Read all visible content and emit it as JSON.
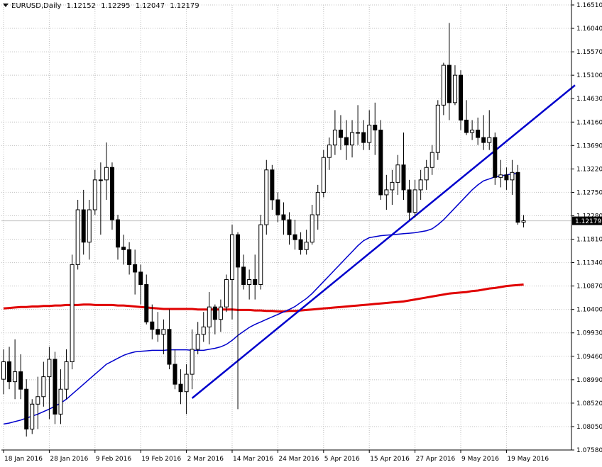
{
  "header": {
    "symbol": "EURUSD,Daily",
    "open": "1.12152",
    "high": "1.12295",
    "low": "1.12047",
    "close": "1.12179"
  },
  "colors": {
    "up_body": "#ffffff",
    "down_body": "#000000",
    "ma_slow": "#e00000",
    "ma_fast": "#0000cc",
    "trendline": "#0000cc",
    "grid": "#c0c0c0",
    "price_label_bg": "#000000"
  },
  "chart_data": {
    "type": "candlestick",
    "ylim": [
      1.0758,
      1.1651
    ],
    "y_ticks": [
      "1.16510",
      "1.16040",
      "1.15570",
      "1.15100",
      "1.14630",
      "1.14160",
      "1.13690",
      "1.13220",
      "1.12750",
      "1.12280",
      "1.11810",
      "1.11340",
      "1.10870",
      "1.10400",
      "1.09930",
      "1.09460",
      "1.08990",
      "1.08520",
      "1.08050",
      "1.07580"
    ],
    "x_labels": [
      {
        "label": "18 Jan 2016",
        "index": 0
      },
      {
        "label": "28 Jan 2016",
        "index": 8
      },
      {
        "label": "9 Feb 2016",
        "index": 16
      },
      {
        "label": "19 Feb 2016",
        "index": 24
      },
      {
        "label": "2 Mar 2016",
        "index": 32
      },
      {
        "label": "14 Mar 2016",
        "index": 40
      },
      {
        "label": "24 Mar 2016",
        "index": 48
      },
      {
        "label": "5 Apr 2016",
        "index": 56
      },
      {
        "label": "15 Apr 2016",
        "index": 64
      },
      {
        "label": "27 Apr 2016",
        "index": 72
      },
      {
        "label": "9 May 2016",
        "index": 80
      },
      {
        "label": "19 May 2016",
        "index": 88
      }
    ],
    "current_price": "1.12179",
    "candles": [
      [
        1.09,
        1.096,
        1.087,
        1.0935
      ],
      [
        1.0935,
        1.0965,
        1.088,
        1.0895
      ],
      [
        1.0895,
        1.098,
        1.086,
        1.0915
      ],
      [
        1.0915,
        1.095,
        1.086,
        1.088
      ],
      [
        1.088,
        1.09,
        1.0785,
        1.08
      ],
      [
        1.08,
        1.086,
        1.079,
        1.085
      ],
      [
        1.085,
        1.0905,
        1.08,
        1.0865
      ],
      [
        1.0865,
        1.0935,
        1.0845,
        1.0905
      ],
      [
        1.0905,
        1.0965,
        1.082,
        1.094
      ],
      [
        1.094,
        1.0955,
        1.081,
        1.083
      ],
      [
        1.083,
        1.092,
        1.081,
        1.088
      ],
      [
        1.088,
        1.096,
        1.086,
        1.0935
      ],
      [
        1.0935,
        1.115,
        1.092,
        1.113
      ],
      [
        1.113,
        1.126,
        1.112,
        1.124
      ],
      [
        1.124,
        1.128,
        1.115,
        1.1175
      ],
      [
        1.1175,
        1.126,
        1.114,
        1.124
      ],
      [
        1.124,
        1.132,
        1.123,
        1.13
      ],
      [
        1.13,
        1.1335,
        1.119,
        1.13
      ],
      [
        1.13,
        1.1375,
        1.126,
        1.1325
      ],
      [
        1.1325,
        1.1335,
        1.12,
        1.122
      ],
      [
        1.122,
        1.123,
        1.114,
        1.1165
      ],
      [
        1.1165,
        1.119,
        1.113,
        1.116
      ],
      [
        1.116,
        1.1175,
        1.111,
        1.113
      ],
      [
        1.113,
        1.116,
        1.107,
        1.1115
      ],
      [
        1.1115,
        1.113,
        1.105,
        1.109
      ],
      [
        1.109,
        1.111,
        1.101,
        1.1015
      ],
      [
        1.1015,
        1.105,
        1.098,
        1.1
      ],
      [
        1.1,
        1.1035,
        1.0975,
        1.099
      ],
      [
        1.099,
        1.102,
        1.095,
        1.1
      ],
      [
        1.1,
        1.104,
        1.092,
        1.093
      ],
      [
        1.093,
        1.096,
        1.088,
        1.089
      ],
      [
        1.089,
        1.092,
        1.085,
        1.0875
      ],
      [
        1.0875,
        1.093,
        1.083,
        1.091
      ],
      [
        1.091,
        1.1,
        1.088,
        1.096
      ],
      [
        1.096,
        1.1015,
        1.095,
        1.099
      ],
      [
        1.099,
        1.1035,
        1.0975,
        1.1005
      ],
      [
        1.1005,
        1.1075,
        1.097,
        1.1045
      ],
      [
        1.1045,
        1.105,
        1.099,
        1.102
      ],
      [
        1.102,
        1.106,
        1.0995,
        1.1045
      ],
      [
        1.1045,
        1.111,
        1.1035,
        1.11
      ],
      [
        1.11,
        1.121,
        1.102,
        1.119
      ],
      [
        1.119,
        1.1195,
        1.084,
        1.1125
      ],
      [
        1.1125,
        1.115,
        1.108,
        1.109
      ],
      [
        1.109,
        1.112,
        1.106,
        1.11
      ],
      [
        1.11,
        1.115,
        1.106,
        1.109
      ],
      [
        1.109,
        1.123,
        1.108,
        1.121
      ],
      [
        1.121,
        1.134,
        1.119,
        1.132
      ],
      [
        1.132,
        1.133,
        1.124,
        1.126
      ],
      [
        1.126,
        1.1275,
        1.1215,
        1.123
      ],
      [
        1.123,
        1.1255,
        1.119,
        1.122
      ],
      [
        1.122,
        1.1235,
        1.117,
        1.119
      ],
      [
        1.119,
        1.122,
        1.116,
        1.118
      ],
      [
        1.118,
        1.1195,
        1.115,
        1.116
      ],
      [
        1.116,
        1.12,
        1.115,
        1.1175
      ],
      [
        1.1175,
        1.125,
        1.117,
        1.123
      ],
      [
        1.123,
        1.129,
        1.12,
        1.1275
      ],
      [
        1.1275,
        1.136,
        1.1265,
        1.1345
      ],
      [
        1.1345,
        1.1385,
        1.132,
        1.137
      ],
      [
        1.137,
        1.144,
        1.135,
        1.14
      ],
      [
        1.14,
        1.143,
        1.136,
        1.1385
      ],
      [
        1.1385,
        1.142,
        1.134,
        1.137
      ],
      [
        1.137,
        1.142,
        1.1345,
        1.1395
      ],
      [
        1.1395,
        1.145,
        1.137,
        1.1395
      ],
      [
        1.1395,
        1.142,
        1.136,
        1.1375
      ],
      [
        1.1375,
        1.144,
        1.136,
        1.141
      ],
      [
        1.141,
        1.1455,
        1.135,
        1.14
      ],
      [
        1.14,
        1.142,
        1.126,
        1.127
      ],
      [
        1.127,
        1.131,
        1.124,
        1.128
      ],
      [
        1.128,
        1.132,
        1.125,
        1.1295
      ],
      [
        1.1295,
        1.135,
        1.127,
        1.133
      ],
      [
        1.133,
        1.1395,
        1.126,
        1.128
      ],
      [
        1.128,
        1.13,
        1.122,
        1.1235
      ],
      [
        1.1235,
        1.13,
        1.1225,
        1.128
      ],
      [
        1.128,
        1.132,
        1.126,
        1.13
      ],
      [
        1.13,
        1.134,
        1.128,
        1.1325
      ],
      [
        1.1325,
        1.137,
        1.131,
        1.1355
      ],
      [
        1.1355,
        1.146,
        1.134,
        1.145
      ],
      [
        1.145,
        1.1535,
        1.143,
        1.153
      ],
      [
        1.153,
        1.1615,
        1.142,
        1.1455
      ],
      [
        1.1455,
        1.153,
        1.145,
        1.151
      ],
      [
        1.151,
        1.152,
        1.14,
        1.142
      ],
      [
        1.142,
        1.146,
        1.139,
        1.1395
      ],
      [
        1.1395,
        1.142,
        1.138,
        1.14
      ],
      [
        1.14,
        1.1425,
        1.137,
        1.1385
      ],
      [
        1.1385,
        1.143,
        1.136,
        1.1375
      ],
      [
        1.1375,
        1.144,
        1.136,
        1.1385
      ],
      [
        1.1385,
        1.1395,
        1.129,
        1.1305
      ],
      [
        1.1305,
        1.134,
        1.1285,
        1.131
      ],
      [
        1.131,
        1.1325,
        1.128,
        1.13
      ],
      [
        1.13,
        1.134,
        1.127,
        1.1315
      ],
      [
        1.1315,
        1.133,
        1.121,
        1.1215
      ],
      [
        1.12152,
        1.12295,
        1.12047,
        1.12179
      ]
    ],
    "series": [
      {
        "name": "",
        "values": [
          1.1042,
          1.1043,
          1.1044,
          1.1045,
          1.1045,
          1.1046,
          1.1046,
          1.1047,
          1.1047,
          1.1048,
          1.1048,
          1.1049,
          1.1049,
          1.1049,
          1.105,
          1.105,
          1.1049,
          1.1049,
          1.1049,
          1.1049,
          1.1048,
          1.1048,
          1.1047,
          1.1046,
          1.1045,
          1.1044,
          1.1043,
          1.1042,
          1.1041,
          1.1041,
          1.1041,
          1.1041,
          1.1041,
          1.1041,
          1.104,
          1.104,
          1.104,
          1.104,
          1.104,
          1.104,
          1.104,
          1.1039,
          1.1039,
          1.1039,
          1.1038,
          1.1038,
          1.1037,
          1.1037,
          1.1036,
          1.1036,
          1.1037,
          1.1037,
          1.1038,
          1.1039,
          1.104,
          1.1041,
          1.1042,
          1.1043,
          1.1044,
          1.1045,
          1.1046,
          1.1047,
          1.1048,
          1.1049,
          1.105,
          1.1051,
          1.1052,
          1.1053,
          1.1054,
          1.1055,
          1.1056,
          1.1058,
          1.106,
          1.1062,
          1.1064,
          1.1066,
          1.1068,
          1.107,
          1.1072,
          1.1073,
          1.1074,
          1.1075,
          1.1077,
          1.1078,
          1.108,
          1.1082,
          1.1083,
          1.1085,
          1.1087,
          1.1088,
          1.1089,
          1.109
        ]
      },
      {
        "name": "",
        "values": [
          1.081,
          1.0812,
          1.0815,
          1.0818,
          1.0822,
          1.0826,
          1.083,
          1.0835,
          1.084,
          1.0846,
          1.0852,
          1.086,
          1.087,
          1.088,
          1.089,
          1.09,
          1.091,
          1.092,
          1.093,
          1.0936,
          1.0942,
          1.0948,
          1.0952,
          1.0955,
          1.0956,
          1.0957,
          1.0958,
          1.0958,
          1.0958,
          1.0959,
          1.0959,
          1.0959,
          1.0959,
          1.0958,
          1.0958,
          1.0958,
          1.096,
          1.0962,
          1.0965,
          1.097,
          1.0978,
          1.0988,
          1.0996,
          1.1004,
          1.101,
          1.1015,
          1.102,
          1.1025,
          1.103,
          1.1035,
          1.104,
          1.1046,
          1.1054,
          1.1062,
          1.1072,
          1.1084,
          1.1096,
          1.1108,
          1.112,
          1.1132,
          1.1144,
          1.1156,
          1.1168,
          1.1178,
          1.1184,
          1.1186,
          1.1188,
          1.1189,
          1.119,
          1.1191,
          1.1192,
          1.1193,
          1.1194,
          1.1196,
          1.1198,
          1.1202,
          1.121,
          1.122,
          1.1232,
          1.1244,
          1.1256,
          1.1268,
          1.128,
          1.129,
          1.1298,
          1.1302,
          1.1306,
          1.1308,
          1.131,
          1.1312,
          1.1313
        ]
      }
    ],
    "trendline": {
      "start": [
        33,
        1.0862
      ],
      "end": [
        100,
        1.149
      ]
    }
  }
}
